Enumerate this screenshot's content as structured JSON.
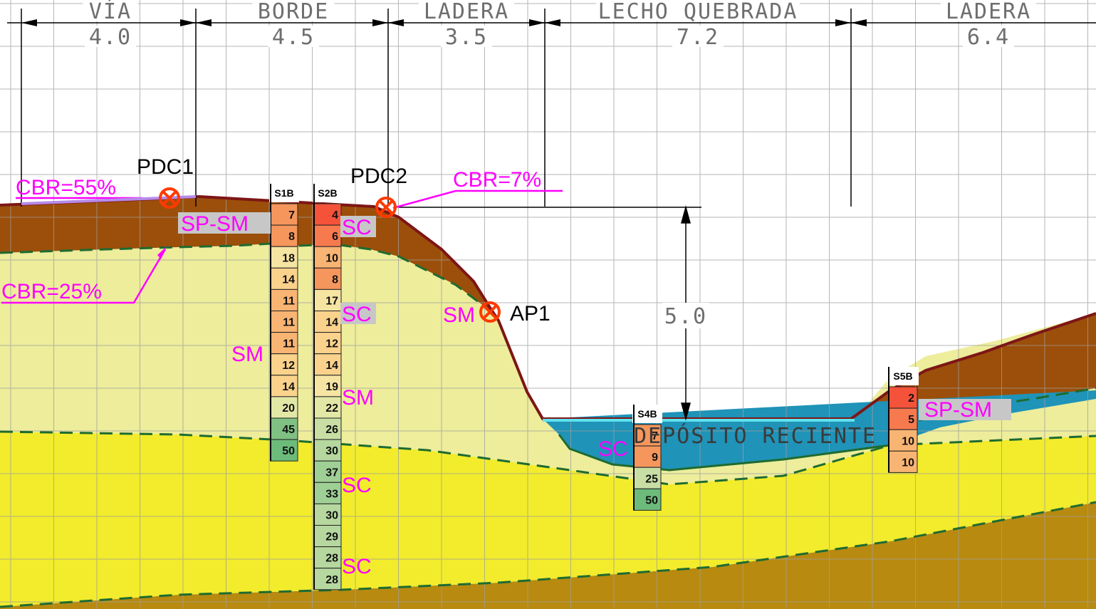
{
  "zones": [
    {
      "name": "VÍA",
      "width": "4.0"
    },
    {
      "name": "BORDE",
      "width": "4.5"
    },
    {
      "name": "LADERA",
      "width": "3.5"
    },
    {
      "name": "LECHO QUEBRADA",
      "width": "7.2"
    },
    {
      "name": "LADERA",
      "width": "6.4"
    }
  ],
  "height_dimension": "5.0",
  "points": [
    {
      "id": "PDC1"
    },
    {
      "id": "PDC2"
    },
    {
      "id": "AP1"
    }
  ],
  "cbr_labels": [
    "CBR=55%",
    "CBR=25%",
    "CBR=7%"
  ],
  "soil_labels": {
    "spsm_left": "SP-SM",
    "sc_s2b_top": "SC",
    "sc_s2b_mid": "SC",
    "sm_left": "SM",
    "sm_s2b": "SM",
    "sm_ap1": "SM",
    "sc_s2b_low": "SC",
    "sc_s2b_bottom": "SC",
    "sc_s4b": "SC",
    "spsm_right": "SP-SM"
  },
  "deposit_label": "DEPÓSITO RECIENTE",
  "boreholes": [
    {
      "name": "S1B",
      "values": [
        "7",
        "8",
        "18",
        "14",
        "11",
        "11",
        "11",
        "12",
        "14",
        "20",
        "45",
        "50"
      ]
    },
    {
      "name": "S2B",
      "values": [
        "4",
        "6",
        "10",
        "8",
        "17",
        "14",
        "12",
        "14",
        "19",
        "22",
        "26",
        "30",
        "37",
        "33",
        "30",
        "29",
        "28",
        "28"
      ]
    },
    {
      "name": "S4B",
      "values": [
        "7",
        "9",
        "25",
        "50"
      ]
    },
    {
      "name": "S5B",
      "values": [
        "2",
        "5",
        "10",
        "10"
      ]
    }
  ],
  "colors": {
    "fill_brown_top": "#9b4f0a",
    "fill_pale_yellow": "#eded9c",
    "fill_yellow": "#f2ec2c",
    "fill_ochre": "#b88a10",
    "fill_deposit": "#1f93b8",
    "contact_dash": "#1e6b30",
    "surface_line": "#7d1616",
    "label_magenta": "#ff00ff",
    "marker_red": "#ff3a00",
    "grid": "#9e9e9e"
  }
}
